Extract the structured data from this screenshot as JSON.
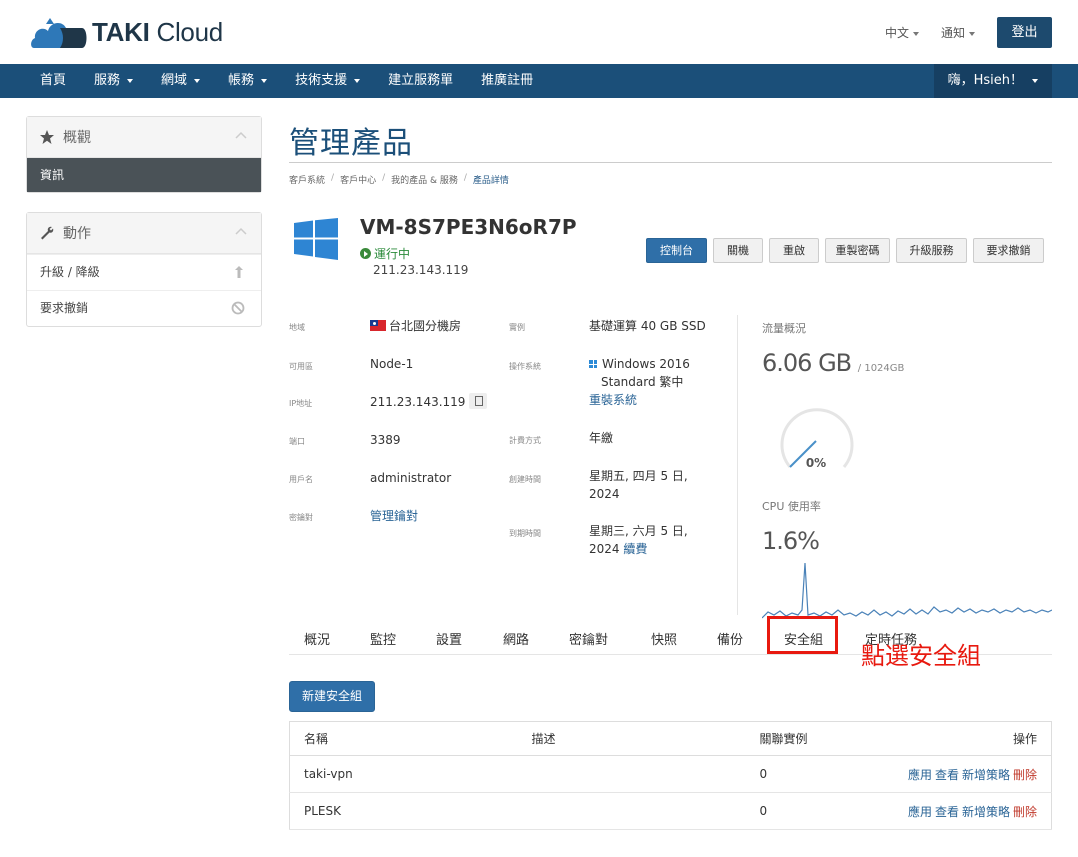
{
  "brand": {
    "bold": "TAKI",
    "rest": "Cloud"
  },
  "top_links": {
    "language": "中文",
    "notifications": "通知",
    "login": "登出"
  },
  "nav": {
    "items": [
      {
        "label": "首頁",
        "caret": false
      },
      {
        "label": "服務",
        "caret": true
      },
      {
        "label": "網域",
        "caret": true
      },
      {
        "label": "帳務",
        "caret": true
      },
      {
        "label": "技術支援",
        "caret": true
      },
      {
        "label": "建立服務單",
        "caret": false
      },
      {
        "label": "推廣註冊",
        "caret": false
      }
    ],
    "user": "嗨，Hsieh！"
  },
  "sidebar": {
    "overview": {
      "title": "概觀",
      "active": "資訊"
    },
    "actions": {
      "title": "動作",
      "items": [
        "升級 / 降級",
        "要求撤銷"
      ]
    }
  },
  "page": {
    "title": "管理產品",
    "breadcrumb": [
      "客戶系統",
      "客戶中心",
      "我的產品 & 服務",
      "產品詳情"
    ]
  },
  "vm": {
    "name": "VM-8S7PE3N6oR7P",
    "status": "運行中",
    "ip": "211.23.143.119"
  },
  "action_buttons": [
    "控制台",
    "關機",
    "重啟",
    "重製密碼",
    "升級服務",
    "要求撤銷"
  ],
  "info": {
    "region_label": "地域",
    "region": "台北國分機房",
    "zone_label": "可用區",
    "zone": "Node-1",
    "ip_label": "IP地址",
    "ip": "211.23.143.119",
    "port_label": "端口",
    "port": "3389",
    "user_label": "用戶名",
    "user": "administrator",
    "key_label": "密鑰對",
    "key": "管理鑰對",
    "instance_label": "實例",
    "instance": "基礎運算 40 GB SSD",
    "os_label": "操作系統",
    "os_line1": "Windows 2016",
    "os_line2": "Standard 繁中",
    "reinstall": "重裝系統",
    "billing_label": "計費方式",
    "billing": "年繳",
    "start_label": "創建時間",
    "start_line1": "星期五, 四月 5 日,",
    "start_line2": "2024",
    "expire_label": "到期時間",
    "expire_line1": "星期三, 六月 5 日,",
    "expire_line2": "2024",
    "renew": "續費"
  },
  "stats": {
    "traffic_label": "流量概況",
    "traffic_used": "6.06 GB",
    "traffic_total": "/ 1024GB",
    "gauge_percent": "0%",
    "gauge_value": 0,
    "cpu_label": "CPU 使用率",
    "cpu_value": "1.6%"
  },
  "tabs": [
    "概況",
    "監控",
    "設置",
    "網路",
    "密鑰對",
    "快照",
    "備份",
    "安全組",
    "定時任務"
  ],
  "annotation": "點選安全組",
  "security_groups": {
    "new_button": "新建安全組",
    "headers": [
      "名稱",
      "描述",
      "關聯實例",
      "操作"
    ],
    "rows": [
      {
        "name": "taki-vpn",
        "desc": "",
        "count": "0"
      },
      {
        "name": "PLESK",
        "desc": "",
        "count": "0"
      }
    ],
    "ops": [
      "應用",
      "查看",
      "新增策略",
      "刪除"
    ]
  },
  "colors": {
    "brand": "#1b4f79",
    "primary_button": "#2f6fa8",
    "highlight": "#e8190f"
  }
}
